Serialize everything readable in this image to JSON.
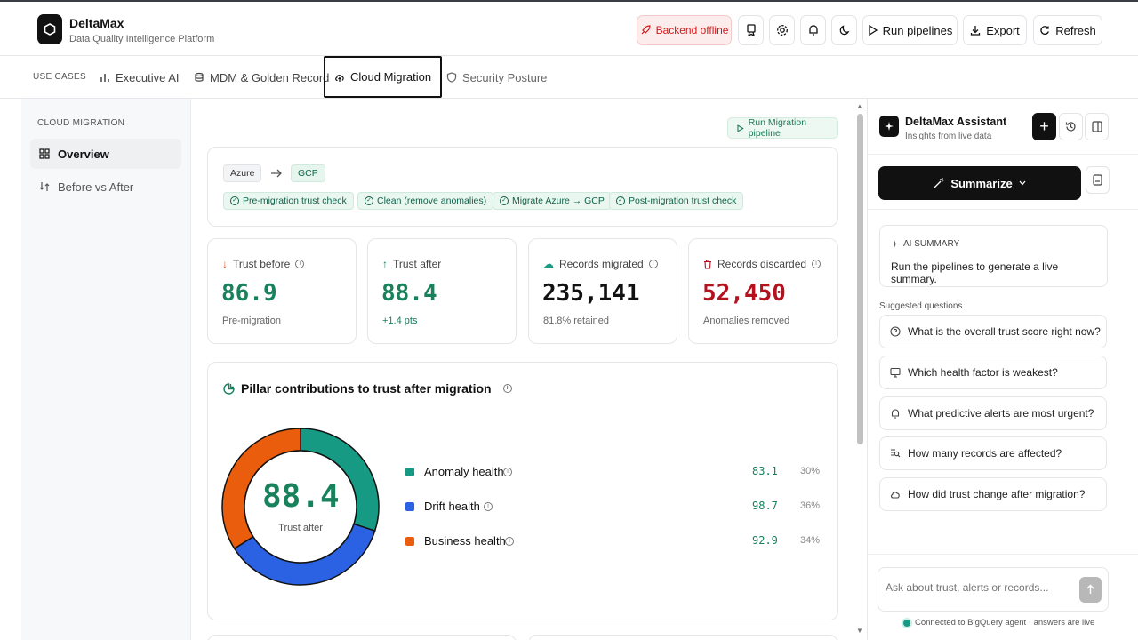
{
  "header": {
    "brand_name": "DeltaMax",
    "brand_sub": "Data Quality Intelligence Platform",
    "backend_status": "Backend offline",
    "run_pipelines": "Run pipelines",
    "export": "Export",
    "refresh": "Refresh"
  },
  "tabs": {
    "label": "USE CASES",
    "items": [
      {
        "label": "Executive AI"
      },
      {
        "label": "MDM & Golden Record"
      },
      {
        "label": "Cloud Migration"
      },
      {
        "label": "Security Posture"
      }
    ]
  },
  "sidebar": {
    "title": "CLOUD MIGRATION",
    "items": [
      {
        "label": "Overview"
      },
      {
        "label": "Before vs After"
      }
    ]
  },
  "main": {
    "run_button": "Run Migration pipeline",
    "flow": {
      "source": "Azure",
      "target": "GCP",
      "steps": [
        "Pre-migration trust check",
        "Clean (remove anomalies)",
        "Migrate Azure → GCP",
        "Post-migration trust check"
      ]
    },
    "kpis": [
      {
        "label": "Trust before",
        "value": "86.9",
        "sub": "Pre-migration",
        "color": "#17825b"
      },
      {
        "label": "Trust after",
        "value": "88.4",
        "sub": "+1.4 pts",
        "color": "#17825b"
      },
      {
        "label": "Records migrated",
        "value": "235,141",
        "sub": "81.8% retained",
        "color": "#111111"
      },
      {
        "label": "Records discarded",
        "value": "52,450",
        "sub": "Anomalies removed",
        "color": "#b3121f"
      }
    ],
    "pillar": {
      "title": "Pillar contributions to trust after migration",
      "center_value": "88.4",
      "center_label": "Trust after",
      "items": [
        {
          "label": "Anomaly health",
          "score": "83.1",
          "pct": "30%",
          "share": 30,
          "color": "#169a84"
        },
        {
          "label": "Drift health",
          "score": "98.7",
          "pct": "36%",
          "share": 36,
          "color": "#2b62e3"
        },
        {
          "label": "Business health",
          "score": "92.9",
          "pct": "34%",
          "share": 34,
          "color": "#ea5d0c"
        }
      ]
    }
  },
  "assistant": {
    "title": "DeltaMax Assistant",
    "subtitle": "Insights from live data",
    "summarize": "Summarize",
    "ai_summary_label": "AI SUMMARY",
    "ai_summary_text": "Run the pipelines to generate a live summary.",
    "suggested_label": "Suggested questions",
    "questions": [
      {
        "text": "What is the overall trust score right now?"
      },
      {
        "text": "Which health factor is weakest?"
      },
      {
        "text": "What predictive alerts are most urgent?"
      },
      {
        "text": "How many records are affected?"
      },
      {
        "text": "How did trust change after migration?"
      }
    ],
    "input_placeholder": "Ask about trust, alerts or records...",
    "footer": "Connected to BigQuery agent · answers are live"
  }
}
